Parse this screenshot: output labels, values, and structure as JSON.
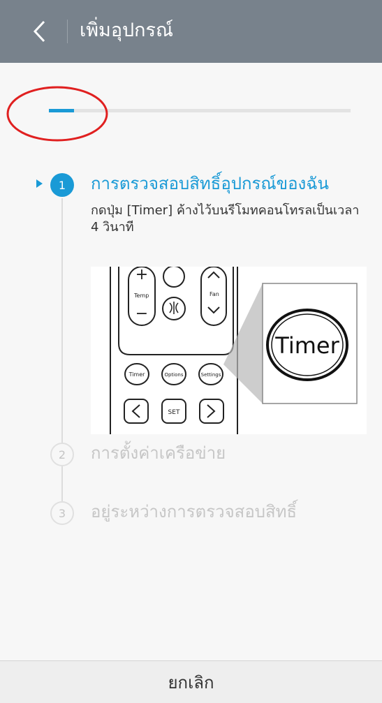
{
  "header": {
    "title": "เพิ่มอุปกรณ์",
    "back_icon": "chevron-left-icon"
  },
  "progress": {
    "fraction": 0.083
  },
  "steps": [
    {
      "number": "1",
      "title": "การตรวจสอบสิทธิ์อุปกรณ์ของฉัน",
      "description": "กดปุ่ม [Timer] ค้างไว้บนรีโมทคอนโทรลเป็นเวลา 4 วินาที",
      "state": "active"
    },
    {
      "number": "2",
      "title": "การตั้งค่าเครือข่าย",
      "state": "inactive"
    },
    {
      "number": "3",
      "title": "อยู่ระหว่างการตรวจสอบสิทธิ์",
      "state": "inactive"
    }
  ],
  "illustration": {
    "remote_labels": {
      "temp": "Temp",
      "fan": "Fan",
      "timer": "Timer",
      "options": "Options",
      "settings": "Settings",
      "set": "SET"
    },
    "zoom_label": "Timer"
  },
  "footer": {
    "cancel_label": "ยกเลิก"
  },
  "colors": {
    "accent": "#1a9ad6",
    "header": "#78828c",
    "annotation": "#e02020"
  }
}
